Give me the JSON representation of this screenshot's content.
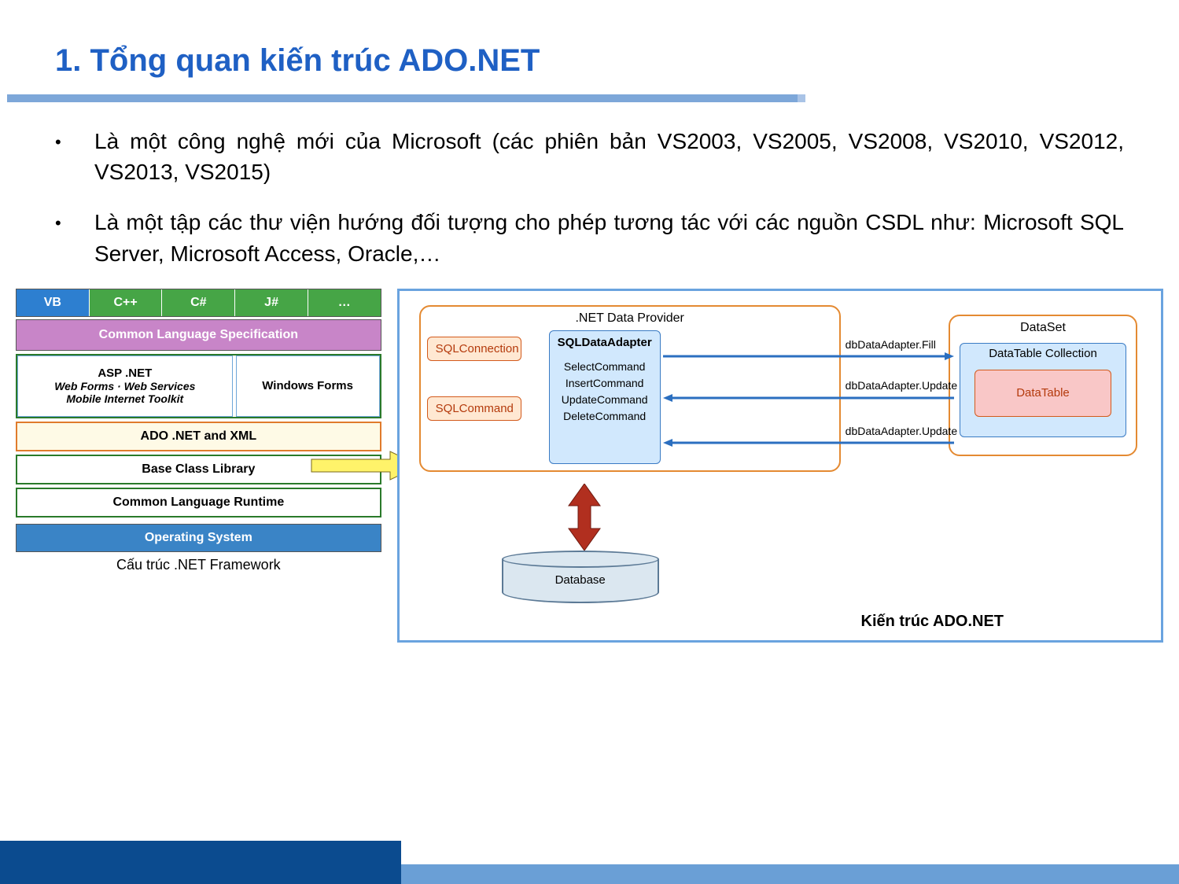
{
  "title": "1. Tổng quan kiến trúc ADO.NET",
  "bullets": [
    "Là một công nghệ mới của Microsoft (các phiên bản VS2003, VS2005, VS2008, VS2010, VS2012, VS2013, VS2015)",
    "Là một tập các thư viện hướng đối tượng cho phép tương tác với các nguồn CSDL như: Microsoft SQL Server, Microsoft Access, Oracle,…"
  ],
  "framework": {
    "languages": [
      "VB",
      "C++",
      "C#",
      "J#",
      "…"
    ],
    "cls": "Common Language Specification",
    "asp": {
      "title": "ASP .NET",
      "sub1": "Web Forms · Web Services",
      "sub2": "Mobile Internet Toolkit"
    },
    "winforms": "Windows Forms",
    "ado": "ADO .NET and XML",
    "bcl": "Base Class Library",
    "clr": "Common Language Runtime",
    "os": "Operating System",
    "caption": "Cấu trúc .NET Framework"
  },
  "ado_arch": {
    "provider_title": ".NET Data Provider",
    "sqlconnection": "SQLConnection",
    "sqlcommand": "SQLCommand",
    "adapter_title": "SQLDataAdapter",
    "adapter_cmds": [
      "SelectCommand",
      "InsertCommand",
      "UpdateCommand",
      "DeleteCommand"
    ],
    "fill_label": "dbDataAdapter.Fill",
    "update_label1": "dbDataAdapter.Update",
    "update_label2": "dbDataAdapter.Update",
    "dataset_title": "DataSet",
    "datatable_collection": "DataTable Collection",
    "datatable": "DataTable",
    "database": "Database",
    "caption": "Kiến trúc ADO.NET"
  }
}
